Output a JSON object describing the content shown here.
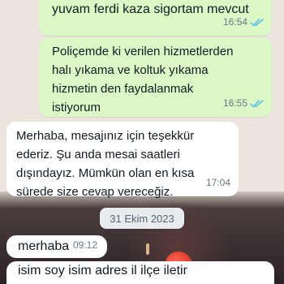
{
  "messages": [
    {
      "direction": "outgoing",
      "text": "yuvam ferdi kaza sigortam mevcut",
      "time": "16:54",
      "status": "read"
    },
    {
      "direction": "outgoing",
      "text": "Poliçemde ki verilen hizmetlerden\nhalı yıkama ve koltuk yıkama\nhizmetin den faydalanmak\nistiyorum",
      "time": "16:55",
      "status": "read"
    },
    {
      "direction": "incoming",
      "text": "Merhaba, mesajınız için teşekkür\nederiz. Şu anda mesai saatleri\ndışındayız. Mümkün olan en kısa\nsürede size cevap vereceğiz.",
      "time": "17:04"
    },
    {
      "direction": "incoming",
      "text": "merhaba",
      "time": "09:12"
    },
    {
      "direction": "incoming",
      "text": "isim soy isim adres il ilçe iletir"
    }
  ],
  "date_separator": "31 Ekim 2023",
  "colors": {
    "outgoing_bubble": "#dcf8c6",
    "incoming_bubble": "#ffffff",
    "read_ticks": "#53bdeb",
    "chat_background": "#ece5dd"
  },
  "icons": {
    "read_receipt": "double-check-icon"
  }
}
